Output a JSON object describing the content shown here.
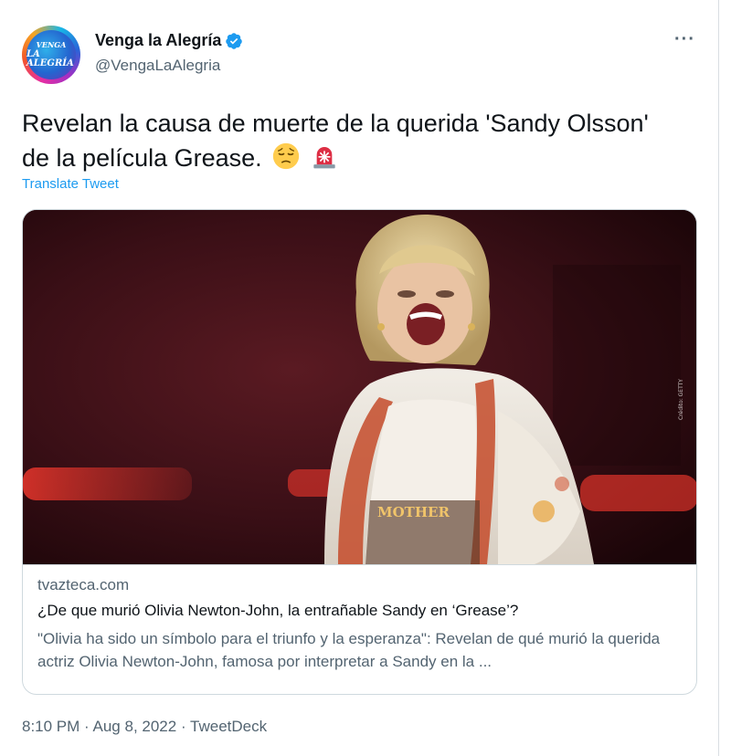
{
  "author": {
    "display_name": "Venga la Alegría",
    "handle": "@VengaLaAlegria",
    "verified": true,
    "avatar_text_line1": "VENGA",
    "avatar_text_line2": "LA ALEGRÍA"
  },
  "more_icon": "more-options-icon",
  "tweet": {
    "text": "Revelan la causa de muerte de la querida 'Sandy Olsson' de la película Grease.",
    "emojis": [
      "pensive-face-emoji",
      "police-light-emoji"
    ],
    "translate_label": "Translate Tweet"
  },
  "card": {
    "image_credit": "Crédito: GETTY",
    "image_shirt_text": "MOTHER",
    "domain": "tvazteca.com",
    "title": "¿De que murió Olivia Newton-John, la entrañable Sandy en ‘Grease’?",
    "description": "\"Olivia ha sido un símbolo para el triunfo y la esperanza\": Revelan de qué murió la querida actriz Olivia Newton-John, famosa por interpretar a Sandy en la ..."
  },
  "meta": {
    "time": "8:10 PM",
    "date": "Aug 8, 2022",
    "source": "TweetDeck",
    "separator": "·"
  },
  "colors": {
    "link_blue": "#1d9bf0",
    "secondary_text": "#536471",
    "primary_text": "#0f1419",
    "border": "#cfd9de"
  }
}
